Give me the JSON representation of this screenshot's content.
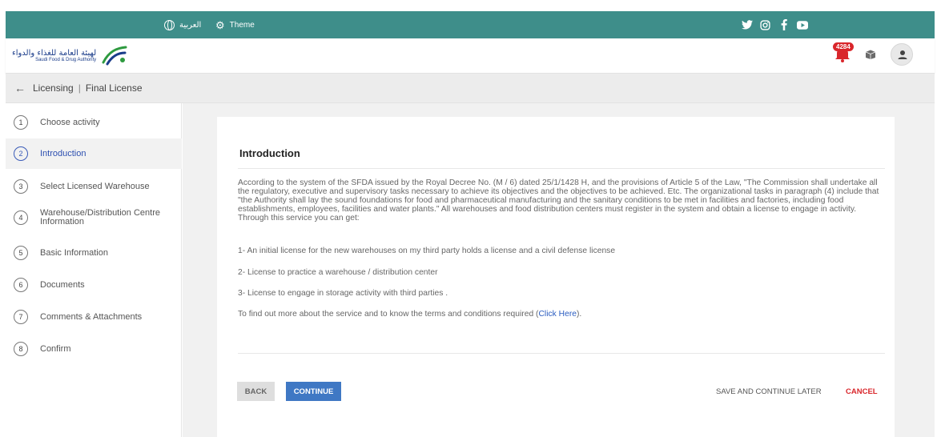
{
  "topbar": {
    "language_label": "العربية",
    "theme_label": "Theme",
    "social_icons": [
      "twitter-icon",
      "instagram-icon",
      "facebook-icon",
      "youtube-icon"
    ],
    "bg_color": "#3e8e8a"
  },
  "header": {
    "logo_ar": "لهيئة العامة للغذاء والدواء",
    "logo_en": "Saudi Food & Drug Authority",
    "notification_count": "4284"
  },
  "breadcrumb": {
    "section": "Licensing",
    "page": "Final License"
  },
  "sidebar": {
    "steps": [
      {
        "num": "1",
        "label": "Choose activity"
      },
      {
        "num": "2",
        "label": "Introduction",
        "active": true
      },
      {
        "num": "3",
        "label": "Select Licensed Warehouse"
      },
      {
        "num": "4",
        "label": "Warehouse/Distribution Centre Information"
      },
      {
        "num": "5",
        "label": "Basic Information"
      },
      {
        "num": "6",
        "label": "Documents"
      },
      {
        "num": "7",
        "label": "Comments & Attachments"
      },
      {
        "num": "8",
        "label": "Confirm"
      }
    ]
  },
  "main": {
    "title": "Introduction",
    "paragraph": "According to the system of the SFDA issued by the Royal Decree No. (M / 6) dated 25/1/1428 H, and the provisions of Article 5 of the Law, \"The Commission shall undertake all the regulatory, executive and supervisory tasks necessary to achieve its objectives and the objectives to be achieved. Etc. The organizational tasks in paragraph (4) include that \"the Authority shall lay the sound foundations for food and pharmaceutical manufacturing and the sanitary conditions to be met in facilities and factories, including food establishments, employees, facilities and water plants.\" All warehouses and food distribution centers must register in the system and obtain a license to engage in activity. Through this service you can get:",
    "items": [
      "1- An initial license for the new warehouses on my third party holds a license and a civil defense license",
      "2- License to practice a warehouse / distribution center",
      "3- License to engage in storage activity with third parties ."
    ],
    "more_info_prefix": "To find out more about the service and to know the terms and conditions required (",
    "more_info_link": "Click Here",
    "more_info_suffix": ")."
  },
  "actions": {
    "back": "BACK",
    "continue": "CONTINUE",
    "save_later": "SAVE AND CONTINUE LATER",
    "cancel": "CANCEL"
  },
  "colors": {
    "accent": "#3f78c4",
    "active_step": "#2c4fb0",
    "danger": "#d9262b"
  }
}
